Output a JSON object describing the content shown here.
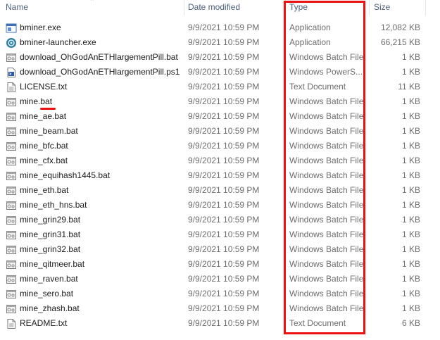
{
  "columns": {
    "name": "Name",
    "date_modified": "Date modified",
    "type": "Type",
    "size": "Size"
  },
  "files": [
    {
      "name": "bminer.exe",
      "date": "9/9/2021 10:59 PM",
      "type": "Application",
      "size": "12,082 KB",
      "icon": "exe-icon"
    },
    {
      "name": "bminer-launcher.exe",
      "date": "9/9/2021 10:59 PM",
      "type": "Application",
      "size": "66,215 KB",
      "icon": "launcher-icon"
    },
    {
      "name": "download_OhGodAnETHlargementPill.bat",
      "date": "9/9/2021 10:59 PM",
      "type": "Windows Batch File",
      "size": "1 KB",
      "icon": "batch-icon"
    },
    {
      "name": "download_OhGodAnETHlargementPill.ps1",
      "date": "9/9/2021 10:59 PM",
      "type": "Windows PowerS...",
      "size": "1 KB",
      "icon": "powershell-icon"
    },
    {
      "name": "LICENSE.txt",
      "date": "9/9/2021 10:59 PM",
      "type": "Text Document",
      "size": "11 KB",
      "icon": "text-file-icon"
    },
    {
      "name": "mine.bat",
      "date": "9/9/2021 10:59 PM",
      "type": "Windows Batch File",
      "size": "1 KB",
      "icon": "batch-icon"
    },
    {
      "name": "mine_ae.bat",
      "date": "9/9/2021 10:59 PM",
      "type": "Windows Batch File",
      "size": "1 KB",
      "icon": "batch-icon"
    },
    {
      "name": "mine_beam.bat",
      "date": "9/9/2021 10:59 PM",
      "type": "Windows Batch File",
      "size": "1 KB",
      "icon": "batch-icon"
    },
    {
      "name": "mine_bfc.bat",
      "date": "9/9/2021 10:59 PM",
      "type": "Windows Batch File",
      "size": "1 KB",
      "icon": "batch-icon"
    },
    {
      "name": "mine_cfx.bat",
      "date": "9/9/2021 10:59 PM",
      "type": "Windows Batch File",
      "size": "1 KB",
      "icon": "batch-icon"
    },
    {
      "name": "mine_equihash1445.bat",
      "date": "9/9/2021 10:59 PM",
      "type": "Windows Batch File",
      "size": "1 KB",
      "icon": "batch-icon"
    },
    {
      "name": "mine_eth.bat",
      "date": "9/9/2021 10:59 PM",
      "type": "Windows Batch File",
      "size": "1 KB",
      "icon": "batch-icon"
    },
    {
      "name": "mine_eth_hns.bat",
      "date": "9/9/2021 10:59 PM",
      "type": "Windows Batch File",
      "size": "1 KB",
      "icon": "batch-icon"
    },
    {
      "name": "mine_grin29.bat",
      "date": "9/9/2021 10:59 PM",
      "type": "Windows Batch File",
      "size": "1 KB",
      "icon": "batch-icon"
    },
    {
      "name": "mine_grin31.bat",
      "date": "9/9/2021 10:59 PM",
      "type": "Windows Batch File",
      "size": "1 KB",
      "icon": "batch-icon"
    },
    {
      "name": "mine_grin32.bat",
      "date": "9/9/2021 10:59 PM",
      "type": "Windows Batch File",
      "size": "1 KB",
      "icon": "batch-icon"
    },
    {
      "name": "mine_qitmeer.bat",
      "date": "9/9/2021 10:59 PM",
      "type": "Windows Batch File",
      "size": "1 KB",
      "icon": "batch-icon"
    },
    {
      "name": "mine_raven.bat",
      "date": "9/9/2021 10:59 PM",
      "type": "Windows Batch File",
      "size": "1 KB",
      "icon": "batch-icon"
    },
    {
      "name": "mine_sero.bat",
      "date": "9/9/2021 10:59 PM",
      "type": "Windows Batch File",
      "size": "1 KB",
      "icon": "batch-icon"
    },
    {
      "name": "mine_zhash.bat",
      "date": "9/9/2021 10:59 PM",
      "type": "Windows Batch File",
      "size": "1 KB",
      "icon": "batch-icon"
    },
    {
      "name": "README.txt",
      "date": "9/9/2021 10:59 PM",
      "type": "Text Document",
      "size": "6 KB",
      "icon": "text-file-icon"
    }
  ],
  "colors": {
    "annotation": "#ee1111",
    "header_text": "#4c607a",
    "secondary_text": "#6d6d6d"
  }
}
